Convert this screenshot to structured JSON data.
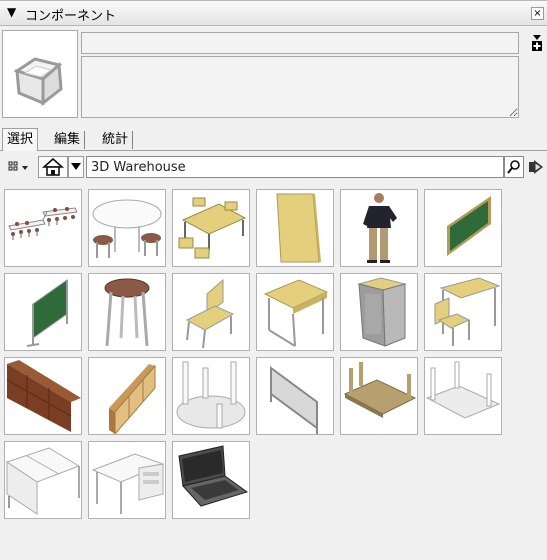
{
  "panel": {
    "title": "コンポーネント",
    "close_glyph": "×"
  },
  "component": {
    "name_value": "",
    "description_value": ""
  },
  "tabs": [
    {
      "label": "選択",
      "active": true
    },
    {
      "label": "編集",
      "active": false
    },
    {
      "label": "統計",
      "active": false
    }
  ],
  "search": {
    "value": "3D Warehouse"
  },
  "components": [
    {
      "icon": "tables-row-icon"
    },
    {
      "icon": "round-table-stools-icon"
    },
    {
      "icon": "table-set-icon"
    },
    {
      "icon": "board-panel-icon"
    },
    {
      "icon": "person-figure-icon"
    },
    {
      "icon": "chalkboard-wall-icon"
    },
    {
      "icon": "chalkboard-stand-icon"
    },
    {
      "icon": "stool-icon"
    },
    {
      "icon": "school-chair-icon"
    },
    {
      "icon": "school-desk-icon"
    },
    {
      "icon": "cabinet-icon"
    },
    {
      "icon": "desk-chair-set-icon"
    },
    {
      "icon": "bookshelf-long-icon"
    },
    {
      "icon": "bookshelf-icon"
    },
    {
      "icon": "round-table-legs-up-icon"
    },
    {
      "icon": "partition-panel-icon"
    },
    {
      "icon": "wood-table-upturned-icon"
    },
    {
      "icon": "white-table-upturned-icon"
    },
    {
      "icon": "double-desk-icon"
    },
    {
      "icon": "office-desk-icon"
    },
    {
      "icon": "laptop-icon"
    }
  ]
}
